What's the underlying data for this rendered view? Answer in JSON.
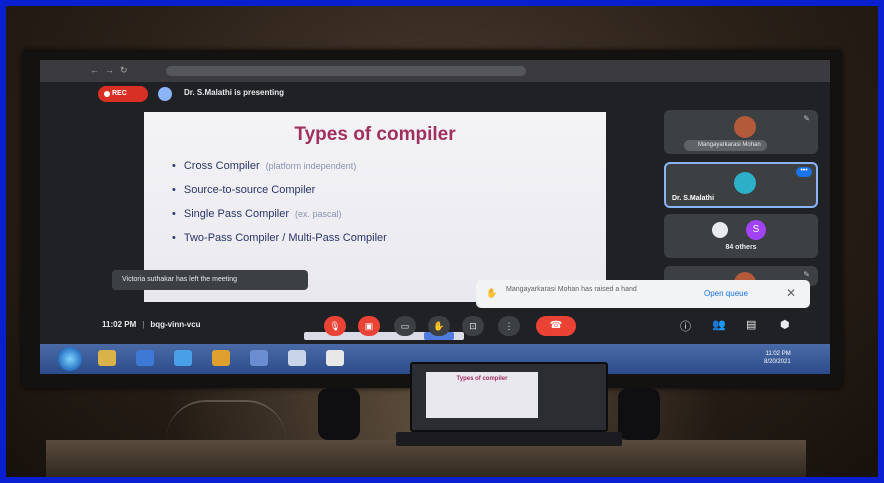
{
  "meet": {
    "rec_label": "REC",
    "presenting": "Dr. S.Malathi is presenting",
    "slide": {
      "title": "Types of compiler",
      "items": [
        {
          "text": "Cross Compiler",
          "note": "(platform independent)"
        },
        {
          "text": "Source-to-source Compiler",
          "note": ""
        },
        {
          "text": "Single Pass Compiler",
          "note": "(ex. pascal)"
        },
        {
          "text": "Two-Pass Compiler /  Multi-Pass Compiler",
          "note": ""
        }
      ]
    },
    "tiles": {
      "participant1_name": "Mangayarkarasi Mohan",
      "participant2_name": "Dr. S.Malathi",
      "others_initial": "S",
      "others_count": "84 others"
    },
    "toast_left": "Victoria suthakar has left the meeting",
    "toast_right": {
      "message": "Mangayarkarasi Mohan has raised a hand",
      "action": "Open queue"
    },
    "time": "11:02 PM",
    "meeting_code": "bqg-vinn-vcu"
  },
  "taskbar": {
    "clock_time": "11:02 PM",
    "clock_date": "8/20/2021"
  },
  "colors": {
    "frame_border": "#0a1fd0",
    "slide_title": "#a1305f",
    "slide_text": "#2a3568",
    "rec_red": "#d93025",
    "hangup_red": "#ea4335"
  }
}
